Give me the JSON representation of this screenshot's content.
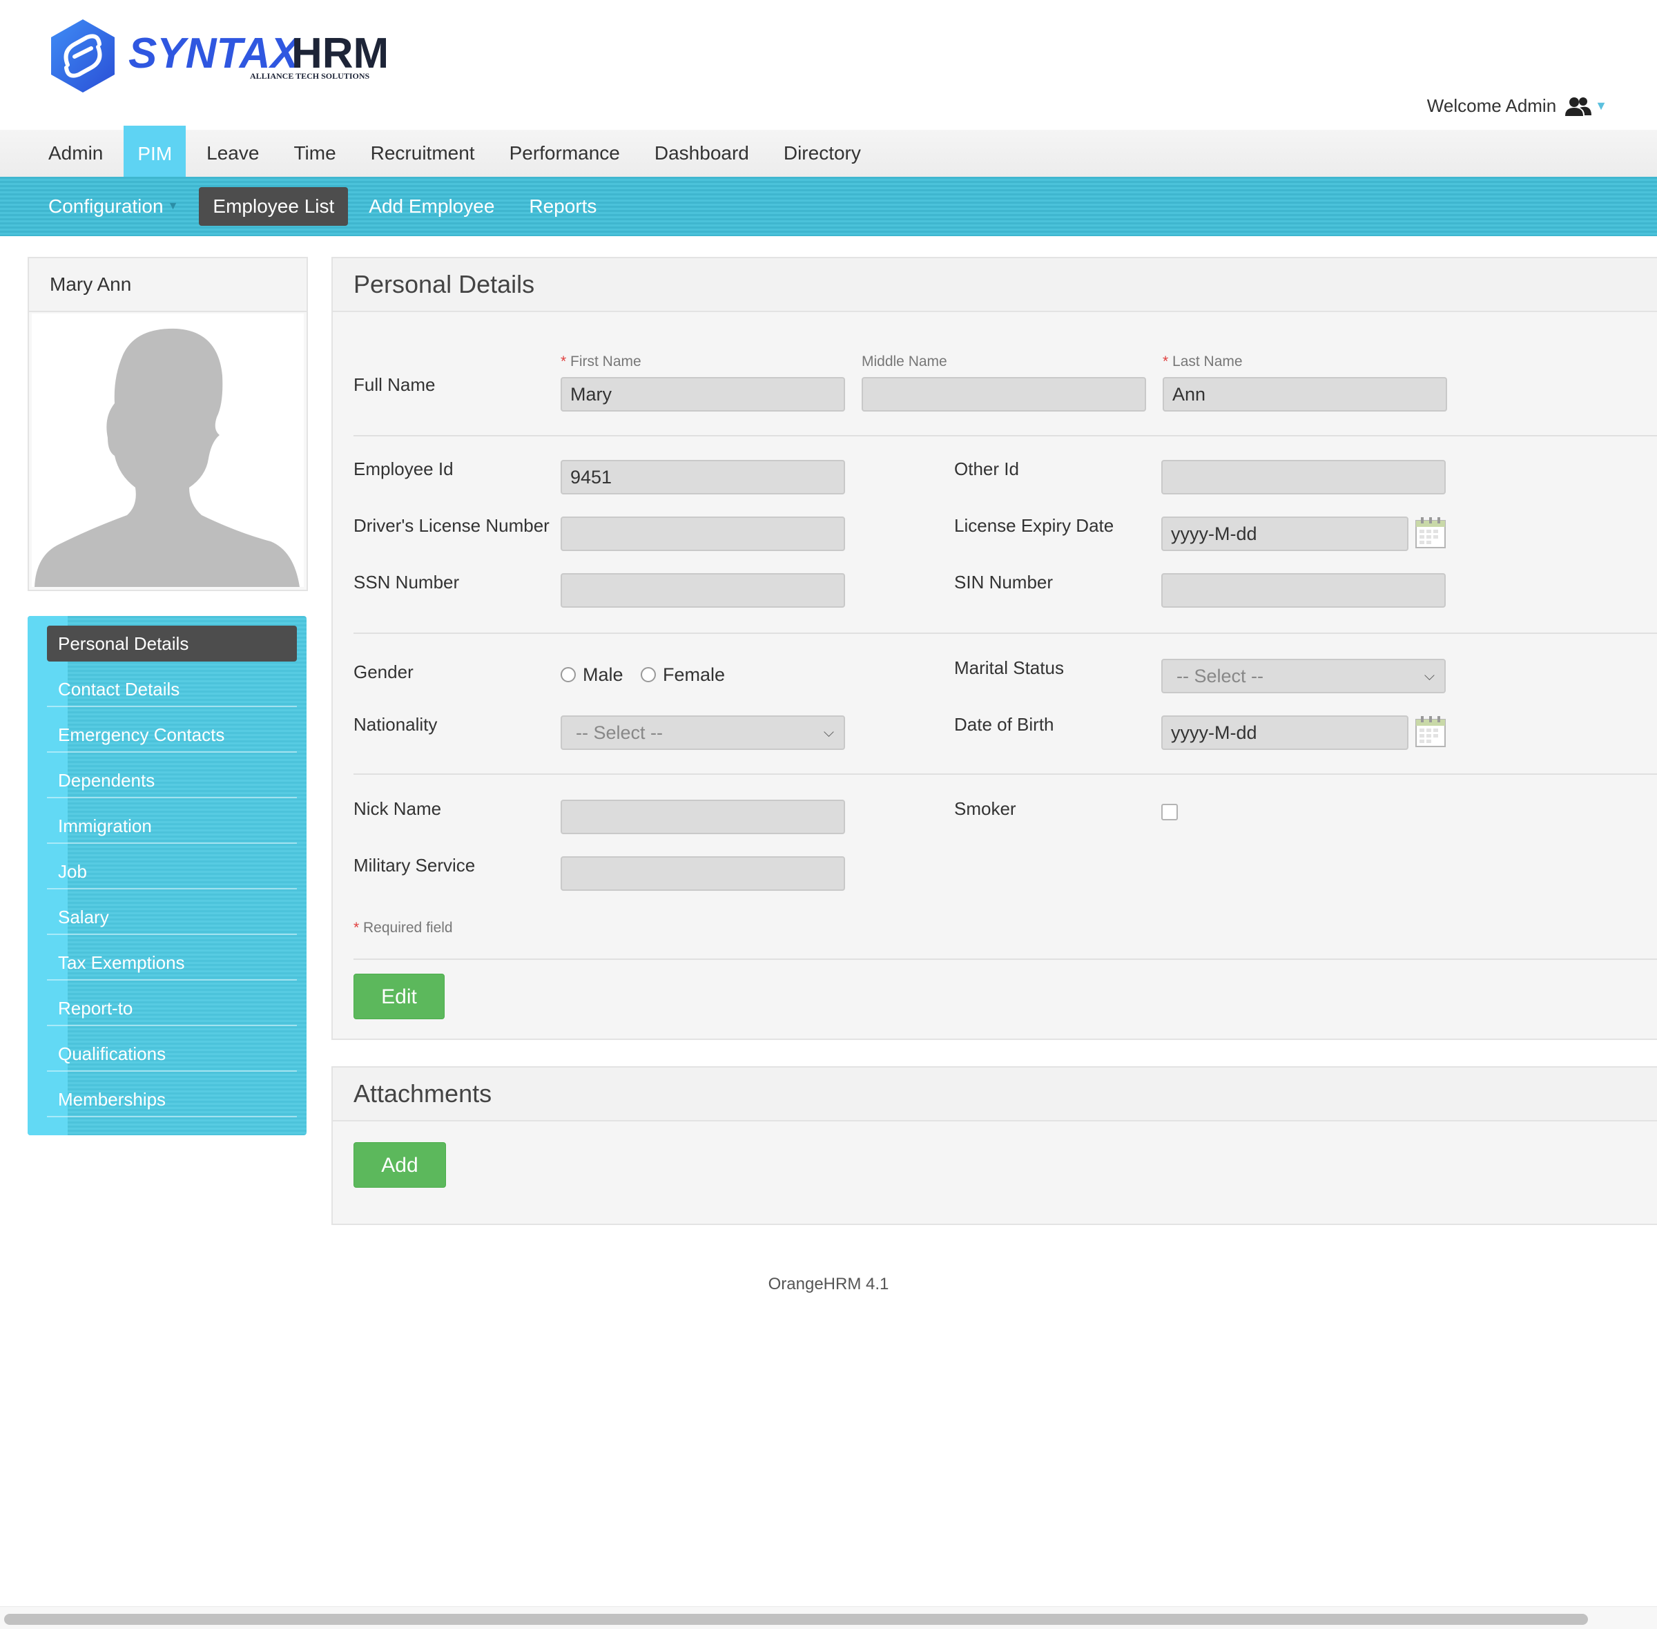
{
  "header": {
    "brand_primary": "SYNTAX",
    "brand_secondary": "HRM",
    "brand_tagline": "ALLIANCE TECH SOLUTIONS",
    "welcome": "Welcome Admin",
    "user_icon": "users-icon"
  },
  "main_menu": [
    "Admin",
    "PIM",
    "Leave",
    "Time",
    "Recruitment",
    "Performance",
    "Dashboard",
    "Directory"
  ],
  "main_menu_active": "PIM",
  "sub_menu": {
    "configuration": "Configuration",
    "employee_list": "Employee List",
    "add_employee": "Add Employee",
    "reports": "Reports"
  },
  "profile": {
    "name": "Mary Ann",
    "photo_icon": "avatar-silhouette"
  },
  "side_nav": [
    "Personal Details",
    "Contact Details",
    "Emergency Contacts",
    "Dependents",
    "Immigration",
    "Job",
    "Salary",
    "Tax Exemptions",
    "Report-to",
    "Qualifications",
    "Memberships"
  ],
  "personal_details": {
    "title": "Personal Details",
    "full_name_label": "Full Name",
    "first_name_label": "First Name",
    "middle_name_label": "Middle Name",
    "last_name_label": "Last Name",
    "first_name": "Mary",
    "middle_name": "",
    "last_name": "Ann",
    "employee_id_label": "Employee Id",
    "employee_id": "9451",
    "other_id_label": "Other Id",
    "other_id": "",
    "drivers_license_label": "Driver's License Number",
    "drivers_license": "",
    "license_expiry_label": "License Expiry Date",
    "license_expiry": "yyyy-M-dd",
    "ssn_label": "SSN Number",
    "ssn": "",
    "sin_label": "SIN Number",
    "sin": "",
    "gender_label": "Gender",
    "gender_male": "Male",
    "gender_female": "Female",
    "marital_status_label": "Marital Status",
    "marital_status": "-- Select --",
    "nationality_label": "Nationality",
    "nationality": "-- Select --",
    "dob_label": "Date of Birth",
    "dob": "yyyy-M-dd",
    "nick_name_label": "Nick Name",
    "nick_name": "",
    "smoker_label": "Smoker",
    "smoker": false,
    "military_label": "Military Service",
    "military": "",
    "required_note": "Required field",
    "edit_button": "Edit"
  },
  "attachments": {
    "title": "Attachments",
    "add_button": "Add"
  },
  "footer": "OrangeHRM 4.1",
  "colors": {
    "accent": "#5ed3f3",
    "submenu": "#45bcd5",
    "button_green": "#5cb85c",
    "active_dark": "#4d4d4d",
    "required_red": "#e0403f"
  }
}
